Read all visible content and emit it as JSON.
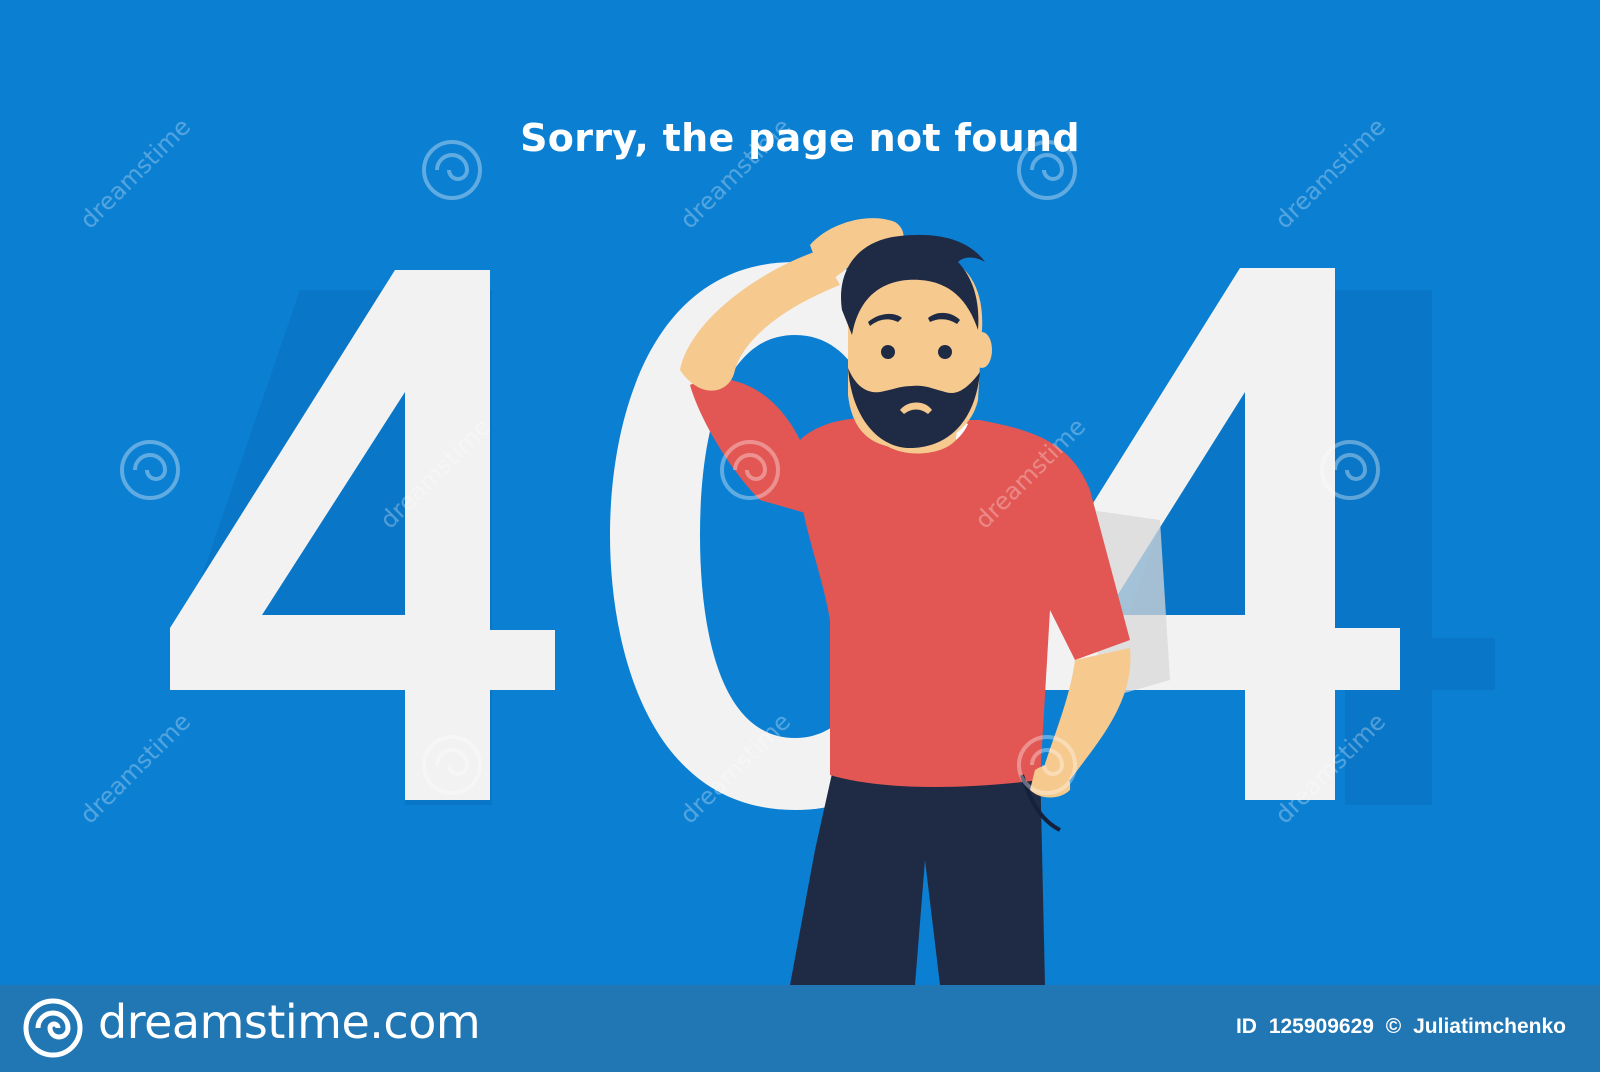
{
  "headline": "Sorry, the page not found",
  "error_code": {
    "first": "4",
    "middle": "0",
    "last": "4"
  },
  "watermark": {
    "text": "dreamstime",
    "icon": "spiral-logo-icon"
  },
  "footer": {
    "brand": "dreamstime.com",
    "logo_icon": "spiral-logo-icon",
    "id_label": "ID",
    "id_value": "125909629",
    "copyright_symbol": "©",
    "author": "Juliatimchenko"
  },
  "colors": {
    "background": "#0b7fd2",
    "digits": "#f2f2f2",
    "shirt": "#e25754",
    "pants": "#1f2b45",
    "skin": "#f6c98f",
    "hair": "#1f2b45",
    "footer": "#2176b4"
  }
}
